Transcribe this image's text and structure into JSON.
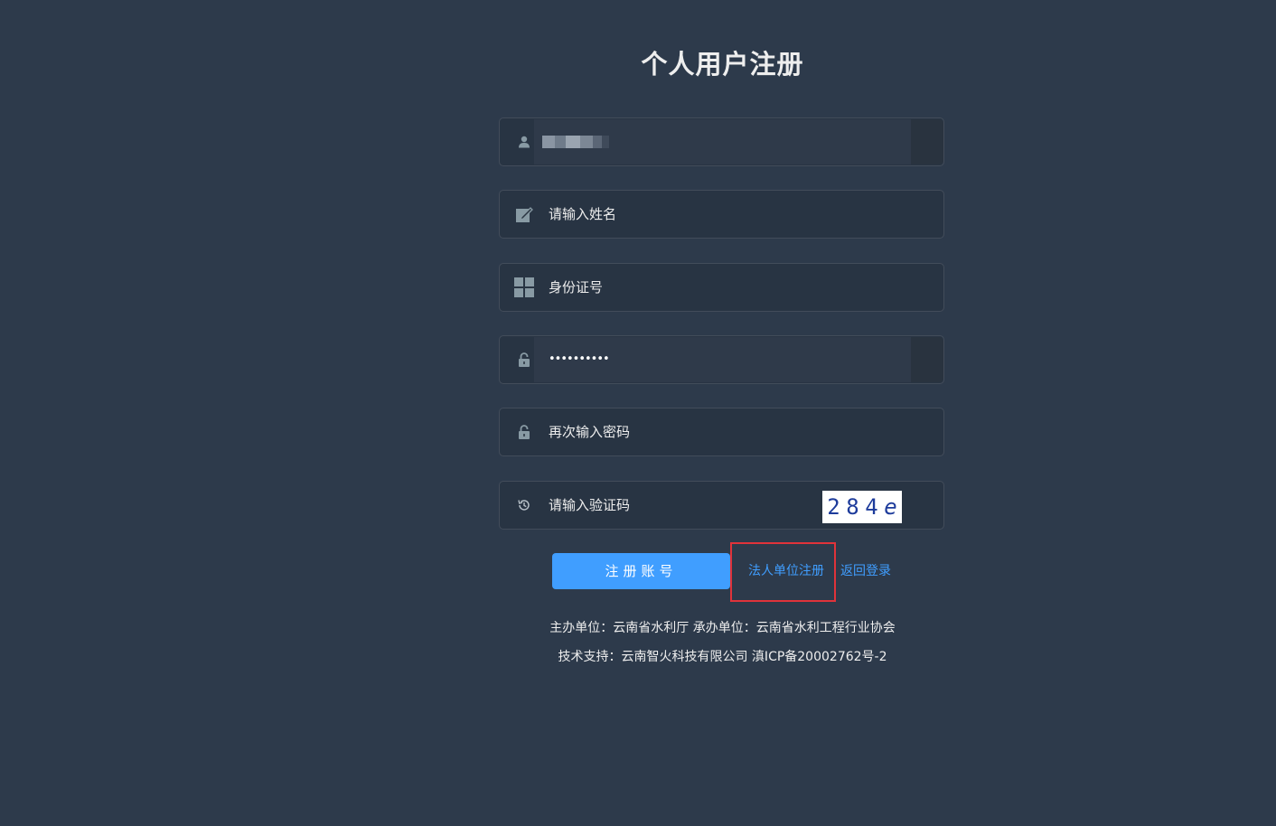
{
  "page": {
    "title": "个人用户注册"
  },
  "form": {
    "username": {
      "icon": "user-icon",
      "value": ""
    },
    "name": {
      "icon": "edit-icon",
      "placeholder": "请输入姓名"
    },
    "id_number": {
      "icon": "grid-icon",
      "placeholder": "身份证号"
    },
    "password": {
      "icon": "lock-icon",
      "value": "••••••••••"
    },
    "confirm_password": {
      "icon": "lock-icon",
      "placeholder": "再次输入密码"
    },
    "captcha": {
      "icon": "history-icon",
      "placeholder": "请输入验证码",
      "image_text": [
        "2",
        "8",
        "4",
        "e"
      ]
    }
  },
  "actions": {
    "submit_label": "注册账号",
    "legal_entity_link": "法人单位注册",
    "back_to_login_link": "返回登录"
  },
  "footer": {
    "line1": "主办单位：云南省水利厅  承办单位：云南省水利工程行业协会",
    "line2": "技术支持：云南智火科技有限公司  滇ICP备20002762号-2"
  },
  "colors": {
    "background": "#2d3a4b",
    "primary": "#409eff",
    "highlight": "#e0333a"
  }
}
